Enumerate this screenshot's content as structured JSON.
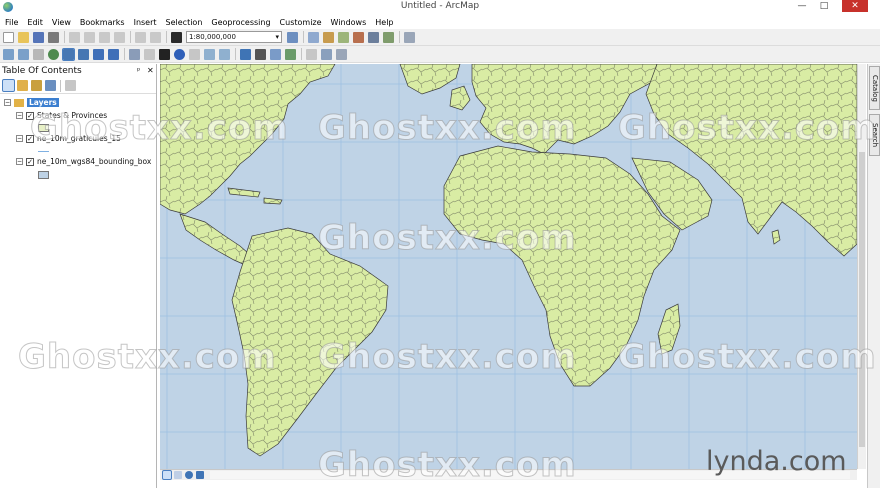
{
  "window": {
    "title": "Untitled - ArcMap",
    "minimize_glyph": "—",
    "maximize_glyph": "□",
    "close_glyph": "✕"
  },
  "menu": {
    "items": [
      "File",
      "Edit",
      "View",
      "Bookmarks",
      "Insert",
      "Selection",
      "Geoprocessing",
      "Customize",
      "Windows",
      "Help"
    ]
  },
  "toolbar": {
    "scale": "1:80,000,000"
  },
  "toc": {
    "title": "Table Of Contents",
    "pin_glyph": "ᵖ",
    "close_glyph": "✕",
    "root": {
      "label": "Layers",
      "expander": "−"
    },
    "layers": [
      {
        "name": "States & Provinces",
        "checked": "✓",
        "expander": "−",
        "symbol": "polygon",
        "symbol_color": "#e7f0c6"
      },
      {
        "name": "ne_10m_graticules_15",
        "checked": "✓",
        "expander": "−",
        "symbol": "line",
        "symbol_color": "#7fb0e2"
      },
      {
        "name": "ne_10m_wgs84_bounding_box",
        "checked": "✓",
        "expander": "−",
        "symbol": "polygon",
        "symbol_color": "#bfd3e6"
      }
    ]
  },
  "map": {
    "ocean_color": "#bfd3e6",
    "land_color": "#d9eca4",
    "border_color": "#3a3a3a",
    "graticule_color": "#9ec0e2"
  },
  "dock": {
    "tabs": [
      "Catalog",
      "Search"
    ]
  },
  "watermarks": {
    "text": "Ghostxx.com",
    "brand": "lynda.com"
  }
}
